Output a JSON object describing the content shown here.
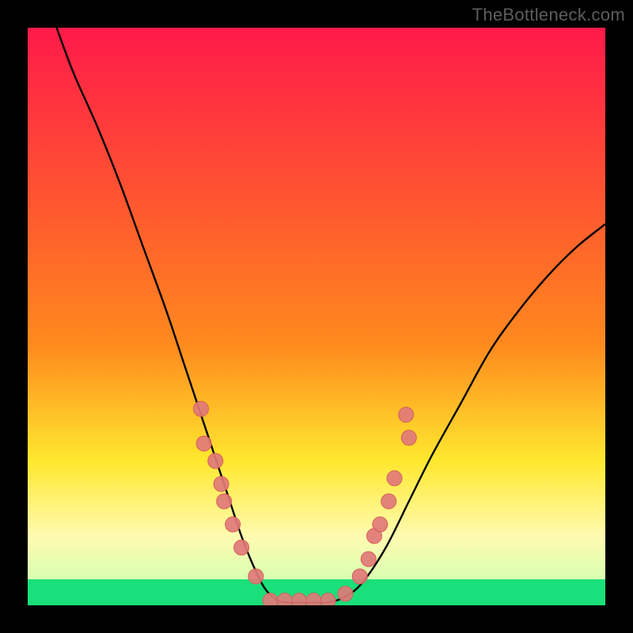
{
  "watermark": "TheBottleneck.com",
  "colors": {
    "frame": "#000000",
    "gradient_top": "#ff1a4a",
    "gradient_mid1": "#ff8a1e",
    "gradient_mid2": "#ffe82e",
    "gradient_mid3": "#fffbb0",
    "gradient_bottom": "#19e07a",
    "curve": "#000000",
    "marker_fill": "#e07a78",
    "marker_stroke": "#d85f5c"
  },
  "chart_data": {
    "type": "line",
    "title": "",
    "xlabel": "",
    "ylabel": "",
    "xlim": [
      0,
      100
    ],
    "ylim": [
      0,
      100
    ],
    "curve": {
      "x": [
        5,
        8,
        12,
        16,
        20,
        24,
        27,
        30,
        33,
        35,
        37,
        39,
        41,
        43,
        45,
        48,
        52,
        55,
        58,
        62,
        66,
        70,
        75,
        80,
        85,
        90,
        95,
        100
      ],
      "y": [
        100,
        92,
        83,
        73,
        62,
        51,
        42,
        33,
        24,
        18,
        12,
        7,
        3,
        1,
        0.5,
        0.5,
        0.5,
        1.5,
        4,
        10,
        18,
        26,
        35,
        44,
        51,
        57,
        62,
        66
      ]
    },
    "markers": [
      {
        "x": 30.0,
        "y": 34
      },
      {
        "x": 30.5,
        "y": 28
      },
      {
        "x": 32.5,
        "y": 25
      },
      {
        "x": 33.5,
        "y": 21
      },
      {
        "x": 34.0,
        "y": 18
      },
      {
        "x": 35.5,
        "y": 14
      },
      {
        "x": 37.0,
        "y": 10
      },
      {
        "x": 39.5,
        "y": 5
      },
      {
        "x": 42.0,
        "y": 0.8
      },
      {
        "x": 44.5,
        "y": 0.8
      },
      {
        "x": 47.0,
        "y": 0.8
      },
      {
        "x": 49.5,
        "y": 0.8
      },
      {
        "x": 52.0,
        "y": 0.8
      },
      {
        "x": 55.0,
        "y": 2
      },
      {
        "x": 57.5,
        "y": 5
      },
      {
        "x": 59.0,
        "y": 8
      },
      {
        "x": 60.0,
        "y": 12
      },
      {
        "x": 61.0,
        "y": 14
      },
      {
        "x": 62.5,
        "y": 18
      },
      {
        "x": 63.5,
        "y": 22
      },
      {
        "x": 66.0,
        "y": 29
      },
      {
        "x": 65.5,
        "y": 33
      }
    ]
  }
}
